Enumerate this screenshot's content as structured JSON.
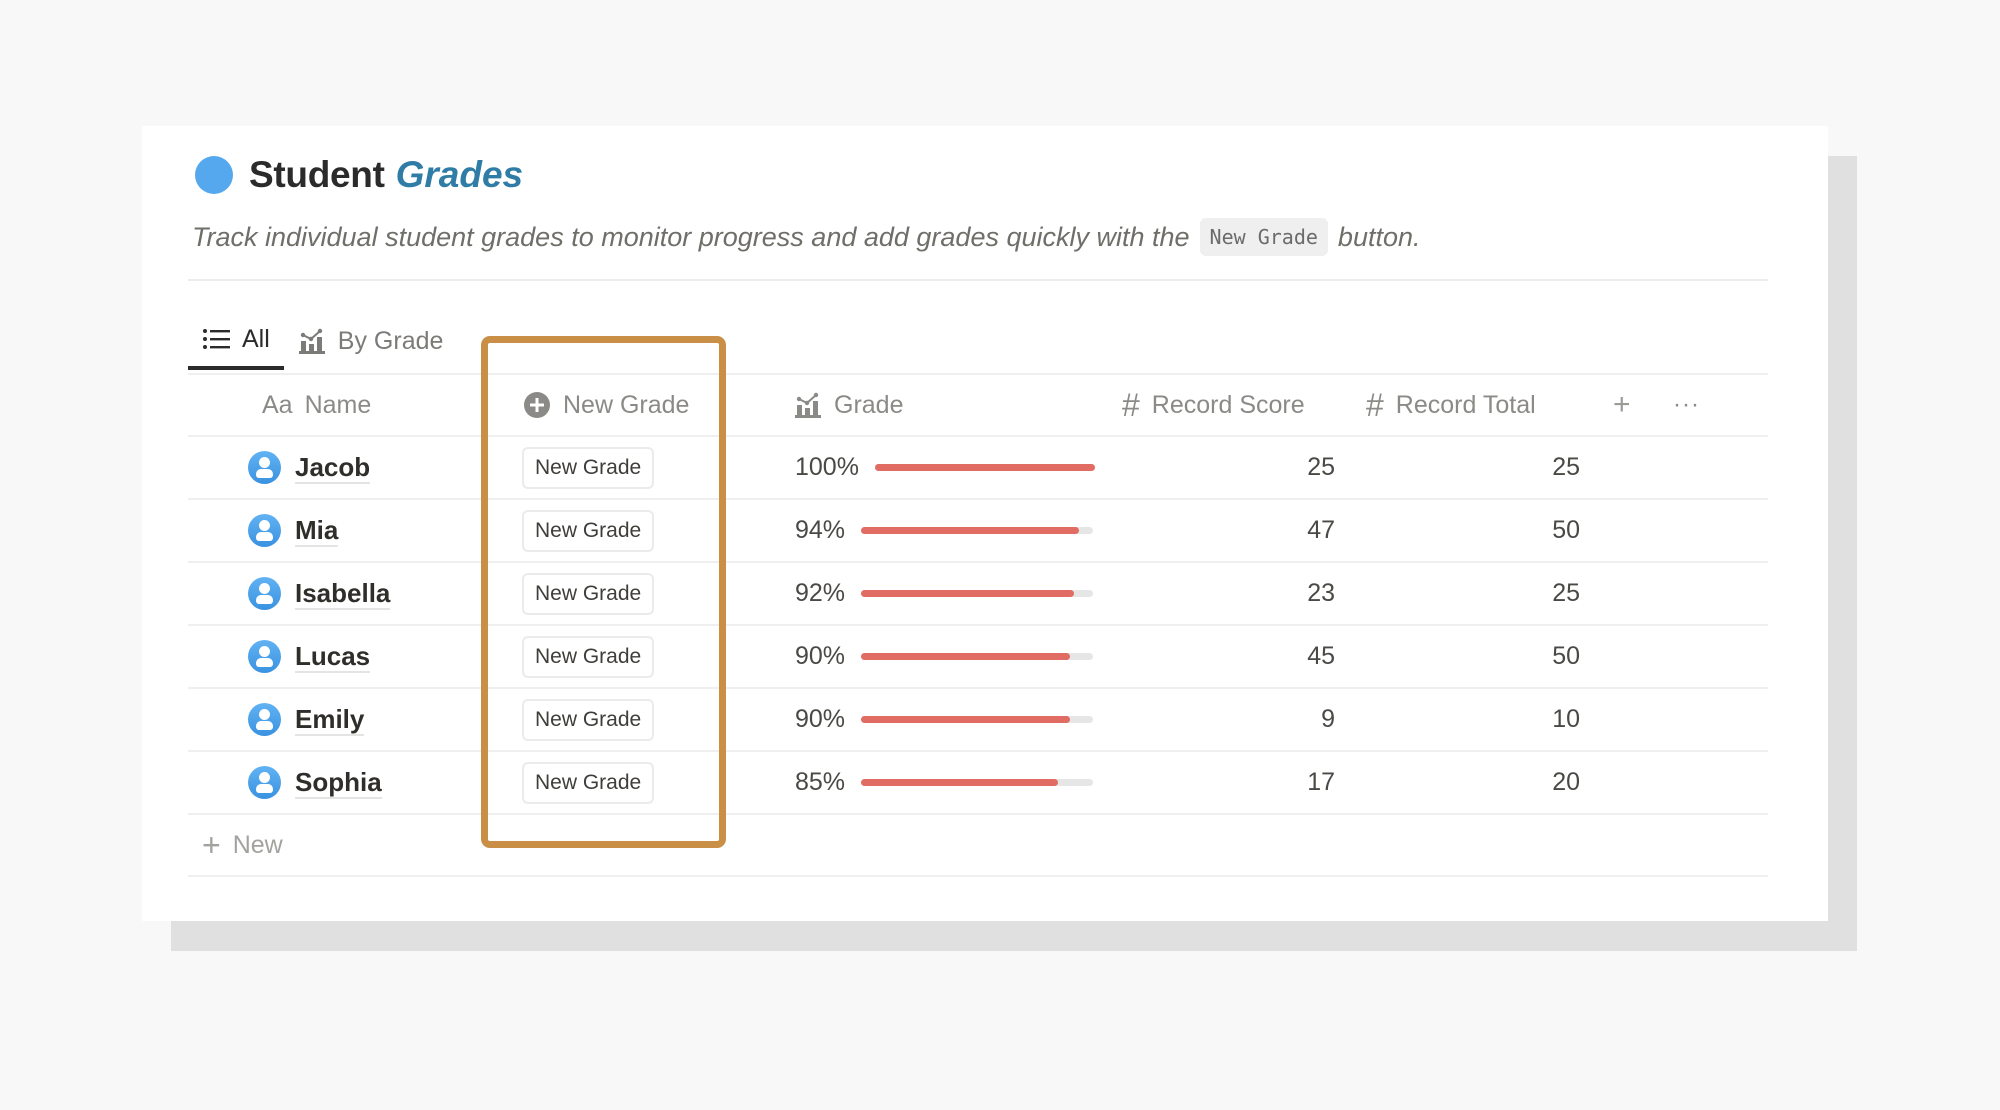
{
  "page": {
    "title": "Student",
    "title_accent": "Grades",
    "description_before": "Track individual student grades to monitor progress and add grades quickly with the",
    "description_code": "New Grade",
    "description_after": "button.",
    "colors": {
      "accent": "#2f7ca6",
      "title_dot": "#55a8ee",
      "progress": "#e06c63",
      "highlight": "#c98f47"
    }
  },
  "tabs": [
    {
      "label": "All",
      "icon": "list-icon",
      "active": true
    },
    {
      "label": "By Grade",
      "icon": "chart-icon",
      "active": false
    }
  ],
  "columns": {
    "name": {
      "prefix": "Aa",
      "label": "Name"
    },
    "new_grade": {
      "label": "New Grade",
      "icon": "plus-circle-icon"
    },
    "grade": {
      "label": "Grade",
      "icon": "chart-icon"
    },
    "record_score": {
      "label": "Record Score",
      "icon": "hash-icon"
    },
    "record_total": {
      "label": "Record Total",
      "icon": "hash-icon"
    },
    "add": "+",
    "more": "···"
  },
  "rows": [
    {
      "name": "Jacob",
      "button": "New Grade",
      "grade": "100%",
      "progress": 1.0,
      "score": "25",
      "total": "25"
    },
    {
      "name": "Mia",
      "button": "New Grade",
      "grade": "94%",
      "progress": 0.94,
      "score": "47",
      "total": "50"
    },
    {
      "name": "Isabella",
      "button": "New Grade",
      "grade": "92%",
      "progress": 0.92,
      "score": "23",
      "total": "25"
    },
    {
      "name": "Lucas",
      "button": "New Grade",
      "grade": "90%",
      "progress": 0.9,
      "score": "45",
      "total": "50"
    },
    {
      "name": "Emily",
      "button": "New Grade",
      "grade": "90%",
      "progress": 0.9,
      "score": "9",
      "total": "10"
    },
    {
      "name": "Sophia",
      "button": "New Grade",
      "grade": "85%",
      "progress": 0.85,
      "score": "17",
      "total": "20"
    }
  ],
  "new_row": {
    "icon": "+",
    "label": "New"
  }
}
